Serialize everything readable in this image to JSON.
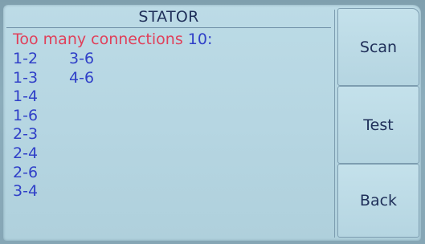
{
  "screen": {
    "title": "STATOR",
    "message_text": "Too many connections",
    "message_count": "10",
    "message_suffix": ":"
  },
  "connections": {
    "column_1": [
      "1-2",
      "1-3",
      "1-4",
      "1-6",
      "2-3",
      "2-4",
      "2-6",
      "3-4"
    ],
    "column_2": [
      "3-6",
      "4-6"
    ]
  },
  "buttons": {
    "scan_label": "Scan",
    "test_label": "Test",
    "back_label": "Back"
  },
  "colors": {
    "title_text": "#20305a",
    "error_text": "#e0405a",
    "value_text": "#3040c8",
    "screen_bg": "#b6d6e2"
  }
}
